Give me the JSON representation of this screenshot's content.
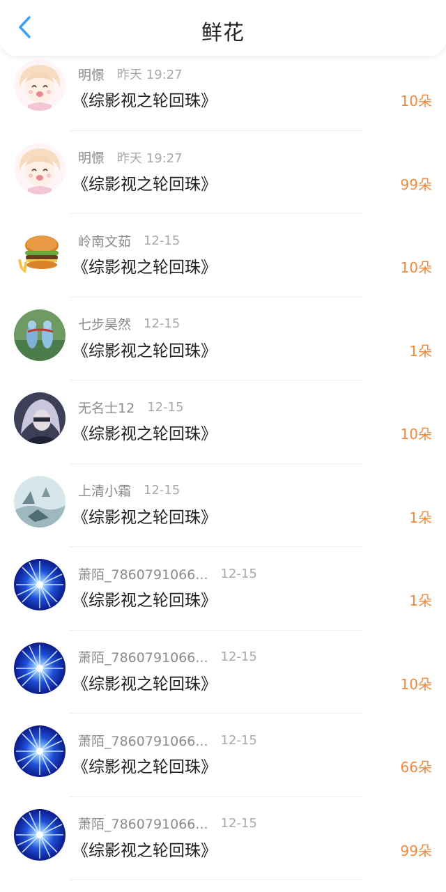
{
  "header": {
    "title": "鲜花",
    "back_icon": "chevron-left-icon",
    "accent_color": "#3a9ff5"
  },
  "flower_color": "#ef8a3c",
  "items": [
    {
      "name": "明憬",
      "time": "昨天 19:27",
      "book": "《综影视之轮回珠》",
      "count": "10朵",
      "avatar": "anime-girl"
    },
    {
      "name": "明憬",
      "time": "昨天 19:27",
      "book": "《综影视之轮回珠》",
      "count": "99朵",
      "avatar": "anime-girl"
    },
    {
      "name": "岭南文茹",
      "time": "12-15",
      "book": "《综影视之轮回珠》",
      "count": "10朵",
      "avatar": "burger"
    },
    {
      "name": "七步昊然",
      "time": "12-15",
      "book": "《综影视之轮回珠》",
      "count": "1朵",
      "avatar": "couple-figures"
    },
    {
      "name": "无名士12",
      "time": "12-15",
      "book": "《综影视之轮回珠》",
      "count": "10朵",
      "avatar": "silver-hair-character"
    },
    {
      "name": "上清小霜",
      "time": "12-15",
      "book": "《综影视之轮回珠》",
      "count": "1朵",
      "avatar": "misty-scenery"
    },
    {
      "name": "萧陌_7860791066...",
      "time": "12-15",
      "book": "《综影视之轮回珠》",
      "count": "1朵",
      "avatar": "blue-star-burst"
    },
    {
      "name": "萧陌_7860791066...",
      "time": "12-15",
      "book": "《综影视之轮回珠》",
      "count": "10朵",
      "avatar": "blue-star-burst"
    },
    {
      "name": "萧陌_7860791066...",
      "time": "12-15",
      "book": "《综影视之轮回珠》",
      "count": "66朵",
      "avatar": "blue-star-burst"
    },
    {
      "name": "萧陌_7860791066...",
      "time": "12-15",
      "book": "《综影视之轮回珠》",
      "count": "99朵",
      "avatar": "blue-star-burst"
    }
  ]
}
